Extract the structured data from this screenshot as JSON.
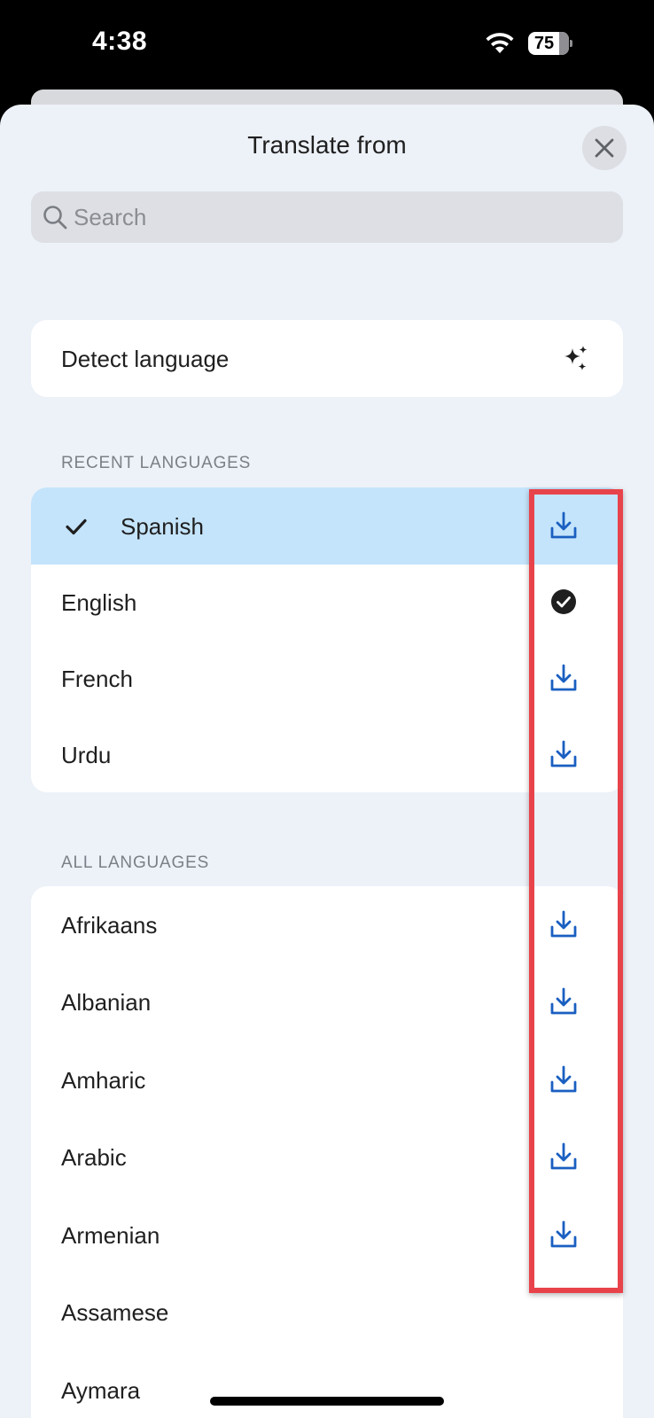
{
  "status_bar": {
    "time": "4:38",
    "battery": "75"
  },
  "sheet": {
    "title": "Translate from"
  },
  "search": {
    "placeholder": "Search"
  },
  "detect": {
    "label": "Detect language"
  },
  "recent": {
    "header": "RECENT LANGUAGES",
    "items": [
      {
        "label": "Spanish",
        "selected": true,
        "action_icon": "download-icon"
      },
      {
        "label": "English",
        "action_icon": "downloaded-check-icon"
      },
      {
        "label": "French",
        "action_icon": "download-icon"
      },
      {
        "label": "Urdu",
        "action_icon": "download-icon"
      }
    ]
  },
  "all": {
    "header": "ALL LANGUAGES",
    "items": [
      {
        "label": "Afrikaans",
        "action_icon": "download-icon"
      },
      {
        "label": "Albanian",
        "action_icon": "download-icon"
      },
      {
        "label": "Amharic",
        "action_icon": "download-icon"
      },
      {
        "label": "Arabic",
        "action_icon": "download-icon"
      },
      {
        "label": "Armenian",
        "action_icon": "download-icon"
      },
      {
        "label": "Assamese",
        "action_icon": ""
      },
      {
        "label": "Aymara",
        "action_icon": ""
      }
    ]
  },
  "colors": {
    "accent": "#1a5fc1",
    "selected_row": "#c4e4fb",
    "highlight_box": "#e8434b",
    "sheet_bg": "#edf1f8"
  }
}
